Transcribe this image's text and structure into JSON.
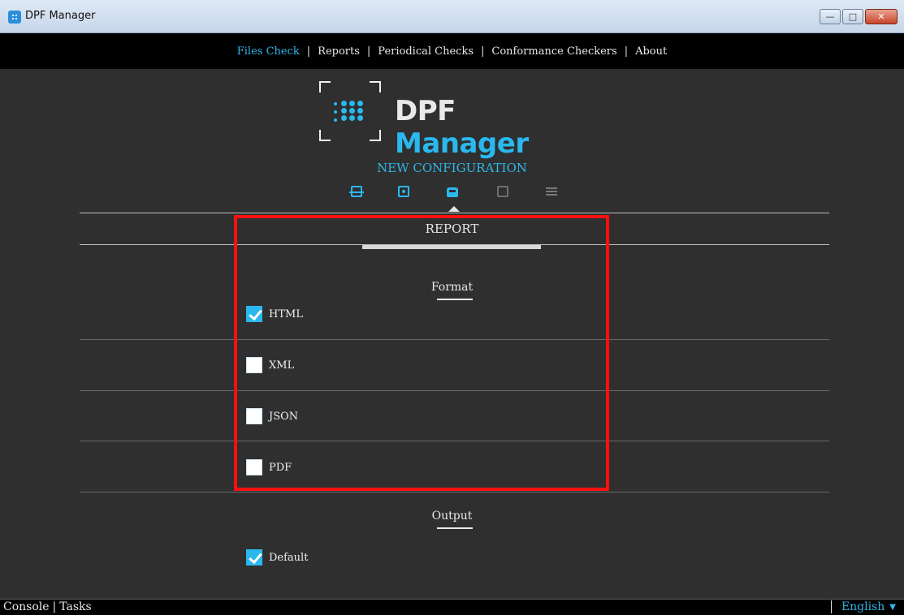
{
  "window": {
    "title": "DPF Manager",
    "app_icon": "dpf-logo-icon"
  },
  "nav": {
    "items": [
      {
        "label": "Files Check",
        "active": true
      },
      {
        "label": "Reports",
        "active": false
      },
      {
        "label": "Periodical Checks",
        "active": false
      },
      {
        "label": "Conformance Checkers",
        "active": false
      },
      {
        "label": "About",
        "active": false
      }
    ],
    "separator": "|"
  },
  "logo": {
    "part1": "DPF",
    "part2": "Manager"
  },
  "page": {
    "heading": "NEW CONFIGURATION",
    "steps": [
      "printer-icon",
      "file-settings-icon",
      "inbox-icon",
      "code-file-icon",
      "list-icon"
    ],
    "active_step": 2,
    "section": "REPORT"
  },
  "format": {
    "title": "Format",
    "options": [
      {
        "label": "HTML",
        "checked": true
      },
      {
        "label": "XML",
        "checked": false
      },
      {
        "label": "JSON",
        "checked": false
      },
      {
        "label": "PDF",
        "checked": false
      }
    ]
  },
  "output": {
    "title": "Output",
    "options": [
      {
        "label": "Default",
        "checked": true
      }
    ]
  },
  "footer": {
    "console": "Console",
    "tasks": "Tasks",
    "language": "English"
  },
  "colors": {
    "accent": "#2ab8ef",
    "highlight": "#ff1010",
    "background": "#2f2f2f"
  }
}
